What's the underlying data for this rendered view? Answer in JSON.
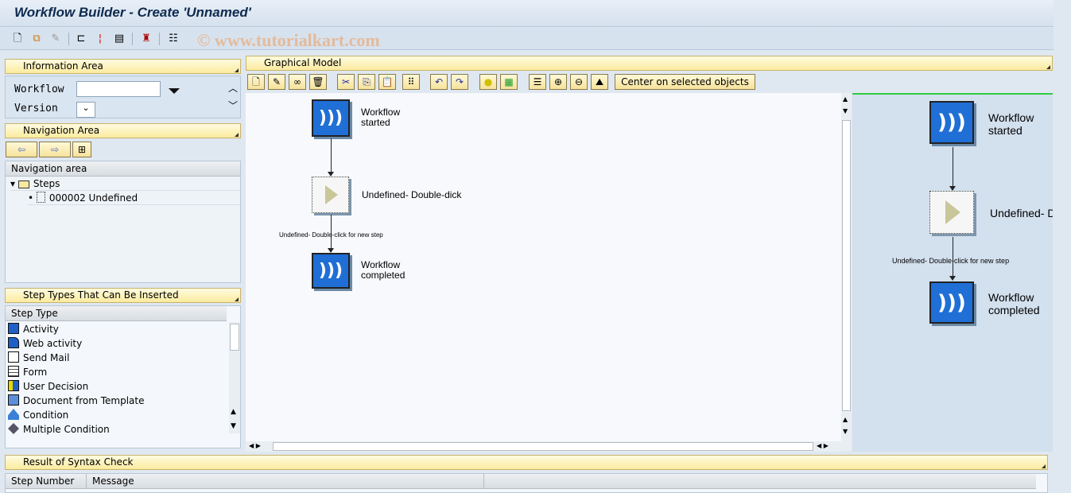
{
  "window": {
    "title": "Workflow Builder - Create 'Unnamed'"
  },
  "watermark": "© www.tutorialkart.com",
  "toolbar": {
    "icons": [
      "new-document-icon",
      "copy-icon",
      "edit-icon",
      "hierarchy-icon",
      "wand-icon",
      "print-icon",
      "hat-icon",
      "list-icon"
    ]
  },
  "info_area": {
    "header": "Information Area",
    "workflow_label": "Workflow",
    "workflow_value": "",
    "version_label": "Version",
    "version_value": ""
  },
  "navigation": {
    "header": "Navigation Area",
    "table_header": "Navigation area",
    "tree": [
      {
        "label": "Steps"
      },
      {
        "label": "000002 Undefined"
      }
    ]
  },
  "step_types": {
    "header": "Step Types That Can Be Inserted",
    "column": "Step Type",
    "items": [
      {
        "label": "Activity",
        "icon": "activity-icon"
      },
      {
        "label": "Web activity",
        "icon": "web-activity-icon"
      },
      {
        "label": "Send Mail",
        "icon": "send-mail-icon"
      },
      {
        "label": "Form",
        "icon": "form-icon"
      },
      {
        "label": "User Decision",
        "icon": "user-decision-icon"
      },
      {
        "label": "Document from Template",
        "icon": "document-template-icon"
      },
      {
        "label": "Condition",
        "icon": "condition-icon"
      },
      {
        "label": "Multiple Condition",
        "icon": "multiple-condition-icon"
      }
    ]
  },
  "graphical_model": {
    "header": "Graphical Model",
    "center_button": "Center on selected objects",
    "nodes": {
      "start": "Workflow\nstarted",
      "undefined": "Undefined- Double-dick",
      "end": "Workflow\ncompleted"
    },
    "edge_label": "Undefined- Double-click for new step",
    "overview": {
      "start": "Workflow\nstarted",
      "undefined": "Undefined- D",
      "end": "Workflow\ncompleted",
      "edge_label": "Undefined- Double-click for new step"
    }
  },
  "syntax_check": {
    "header": "Result of Syntax Check",
    "columns": [
      "Step Number",
      "Message"
    ]
  },
  "colors": {
    "panel_header": "#fbeb9e",
    "node_blue": "#1f6fd6",
    "overview_bg": "#d3e0ee",
    "accent_green": "#2ecc40"
  }
}
